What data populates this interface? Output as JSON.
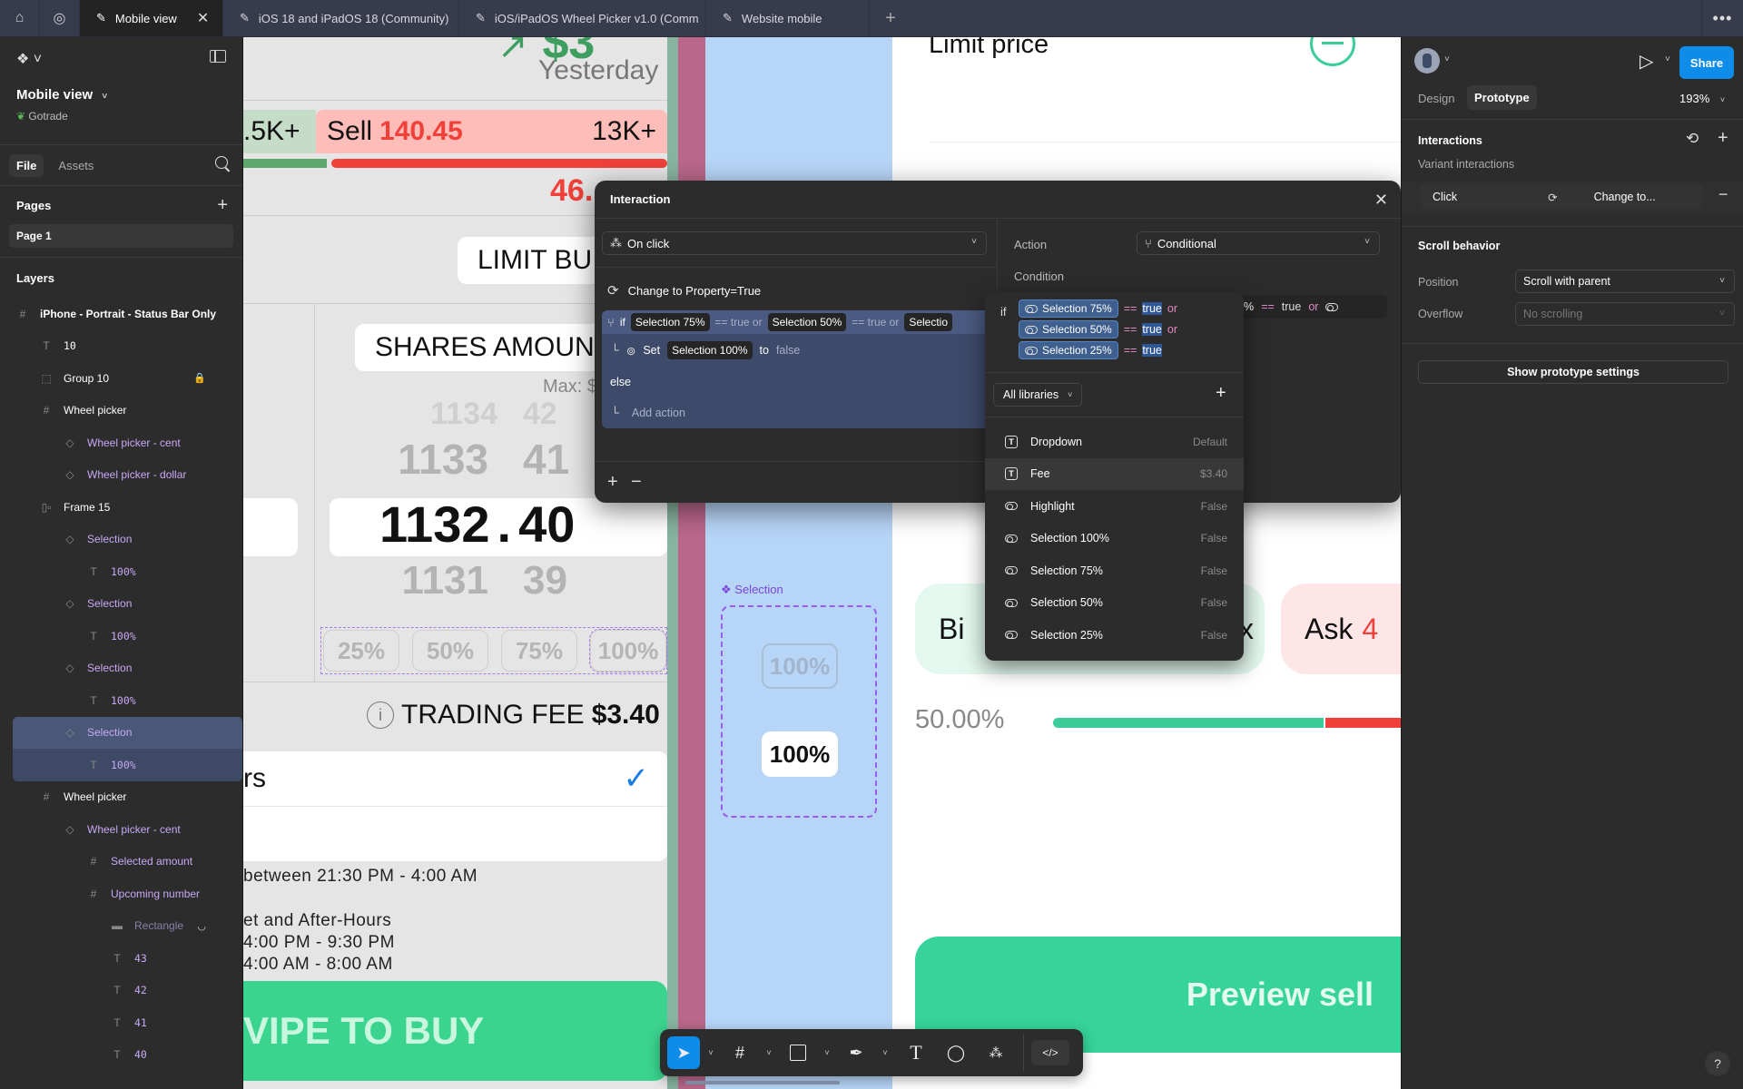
{
  "tabbar": {
    "home_icon": "home-icon",
    "community_icon": "globe-icon",
    "tabs": [
      {
        "label": "Mobile view",
        "active": true
      },
      {
        "label": "iOS 18 and iPadOS 18 (Community)",
        "active": false
      },
      {
        "label": "iOS/iPadOS Wheel Picker v1.0 (Comm",
        "active": false
      },
      {
        "label": "Website mobile",
        "active": false
      }
    ],
    "close_glyph": "✕",
    "add_glyph": "+",
    "more_glyph": "•••"
  },
  "left_panel": {
    "file_name": "Mobile view",
    "team": "Gotrade",
    "tabs": [
      "File",
      "Assets"
    ],
    "pages_title": "Pages",
    "pages": [
      "Page 1"
    ],
    "layers_title": "Layers",
    "layers": [
      {
        "name": "iPhone - Portrait - Status Bar Only",
        "icon": "#",
        "indent": 0,
        "type": "frame",
        "bold": true
      },
      {
        "name": "10",
        "icon": "T",
        "indent": 1,
        "type": "text"
      },
      {
        "name": "Group 10",
        "icon": "⬚",
        "indent": 1,
        "type": "group",
        "locked": true
      },
      {
        "name": "Wheel picker",
        "icon": "#",
        "indent": 1,
        "type": "frame"
      },
      {
        "name": "Wheel picker - cent",
        "icon": "◇",
        "indent": 2,
        "type": "instance"
      },
      {
        "name": "Wheel picker - dollar",
        "icon": "◇",
        "indent": 2,
        "type": "instance"
      },
      {
        "name": "Frame 15",
        "icon": "▯▫",
        "indent": 1,
        "type": "frame"
      },
      {
        "name": "Selection",
        "icon": "◇",
        "indent": 2,
        "type": "instance"
      },
      {
        "name": "100%",
        "icon": "T",
        "indent": 3,
        "type": "instance-text"
      },
      {
        "name": "Selection",
        "icon": "◇",
        "indent": 2,
        "type": "instance"
      },
      {
        "name": "100%",
        "icon": "T",
        "indent": 3,
        "type": "instance-text"
      },
      {
        "name": "Selection",
        "icon": "◇",
        "indent": 2,
        "type": "instance"
      },
      {
        "name": "100%",
        "icon": "T",
        "indent": 3,
        "type": "instance-text"
      },
      {
        "name": "Selection",
        "icon": "◇",
        "indent": 2,
        "type": "instance",
        "selected": true
      },
      {
        "name": "100%",
        "icon": "T",
        "indent": 3,
        "type": "instance-text",
        "selected_child": true
      },
      {
        "name": "Wheel picker",
        "icon": "#",
        "indent": 1,
        "type": "frame"
      },
      {
        "name": "Wheel picker - cent",
        "icon": "◇",
        "indent": 2,
        "type": "instance"
      },
      {
        "name": "Selected amount",
        "icon": "#",
        "indent": 3,
        "type": "instance-frame"
      },
      {
        "name": "Upcoming number",
        "icon": "#",
        "indent": 3,
        "type": "instance-frame"
      },
      {
        "name": "Rectangle",
        "icon": "▬",
        "indent": 4,
        "type": "hidden",
        "hidden": true
      },
      {
        "name": "43",
        "icon": "T",
        "indent": 4,
        "type": "instance-text"
      },
      {
        "name": "42",
        "icon": "T",
        "indent": 4,
        "type": "instance-text"
      },
      {
        "name": "41",
        "icon": "T",
        "indent": 4,
        "type": "instance-text"
      },
      {
        "name": "40",
        "icon": "T",
        "indent": 4,
        "type": "instance-text"
      }
    ]
  },
  "canvas": {
    "phone_a": {
      "change_value": "$3",
      "yesterday": "Yesterday",
      "buy_count": ".5K+",
      "sell_label": "Sell",
      "sell_price": "140.45",
      "sell_count": "13K+",
      "sell_percent": "46.",
      "limit_buy": "LIMIT BU",
      "shares_amount": "SHARES AMOUN",
      "max_label": "Max: $",
      "wheel_rows": [
        {
          "left": "1134",
          "right": "42"
        },
        {
          "left": "1133",
          "right": "41"
        },
        {
          "left": "1131",
          "right": "39"
        }
      ],
      "wheel_selected_left": "1132",
      "wheel_selected_sep": ".",
      "wheel_selected_right": "40",
      "percent_buttons": [
        "25%",
        "50%",
        "75%",
        "100%"
      ],
      "trading_fee_label": "TRADING FEE",
      "trading_fee_value": "$3.40",
      "hours_option": "rs",
      "hours_note": "between 21:30 PM - 4:00 AM",
      "ext_title": "et and After-Hours",
      "ext_line1": "4:00 PM - 9:30 PM",
      "ext_line2": "4:00 AM - 8:00 AM",
      "swipe_label": "VIPE TO BUY"
    },
    "selection_component": {
      "label": "Selection",
      "variant_off": "100%",
      "variant_on": "100%"
    },
    "phone_b": {
      "limit_price": "Limit price",
      "bid_label": "Bi",
      "max_fragment": "x",
      "ask_label": "Ask",
      "ask_value": "4",
      "percent": "50.00%",
      "preview_sell": "Preview sell",
      "bar_split": 0.5
    }
  },
  "dialog": {
    "title": "Interaction",
    "trigger": "On click",
    "change_to": "Change to Property=True",
    "condition_if": "if",
    "cond_items": [
      {
        "var": "Selection 75%",
        "op": "== true or"
      },
      {
        "var": "Selection 50%",
        "op": "== true or"
      },
      {
        "var": "Selectio",
        "op": ""
      }
    ],
    "set_label": "Set",
    "set_var": "Selection 100%",
    "set_to": "to",
    "set_value": "false",
    "else_label": "else",
    "add_action": "Add action",
    "action_label": "Action",
    "action_value": "Conditional",
    "condition_label": "Condition",
    "right_cond_fragment": "ion 50%",
    "right_cond_op": "== true",
    "right_cond_or": "or"
  },
  "popover": {
    "if_label": "if",
    "conditions": [
      {
        "var": "Selection 75%",
        "op": "==",
        "value": "true",
        "join": "or"
      },
      {
        "var": "Selection 50%",
        "op": "==",
        "value": "true",
        "join": "or"
      },
      {
        "var": "Selection 25%",
        "op": "==",
        "value": "true",
        "join": ""
      }
    ],
    "library_filter": "All libraries",
    "variables": [
      {
        "name": "Dropdown",
        "value": "Default",
        "kind": "text"
      },
      {
        "name": "Fee",
        "value": "$3.40",
        "kind": "text",
        "hover": true
      },
      {
        "name": "Highlight",
        "value": "False",
        "kind": "bool"
      },
      {
        "name": "Selection 100%",
        "value": "False",
        "kind": "bool"
      },
      {
        "name": "Selection 75%",
        "value": "False",
        "kind": "bool"
      },
      {
        "name": "Selection 50%",
        "value": "False",
        "kind": "bool"
      },
      {
        "name": "Selection 25%",
        "value": "False",
        "kind": "bool"
      }
    ]
  },
  "right_panel": {
    "share": "Share",
    "tabs": [
      "Design",
      "Prototype"
    ],
    "active_tab": "Prototype",
    "zoom": "193%",
    "interactions_title": "Interactions",
    "variant_interactions": "Variant interactions",
    "interaction_trigger": "Click",
    "interaction_action": "Change to...",
    "scroll_title": "Scroll behavior",
    "position_label": "Position",
    "position_value": "Scroll with parent",
    "overflow_label": "Overflow",
    "overflow_value": "No scrolling",
    "prototype_settings": "Show prototype settings"
  },
  "toolbar": {
    "tools": [
      "move",
      "frame",
      "rectangle",
      "pen",
      "text",
      "comment",
      "actions",
      "dev-mode"
    ]
  },
  "help": "?",
  "colors": {
    "accent": "#0d8ce9",
    "sell_red": "#f1403a",
    "buy_green": "#36d399",
    "component_purple": "#9747ff",
    "selection_layer": "#4a5878"
  }
}
